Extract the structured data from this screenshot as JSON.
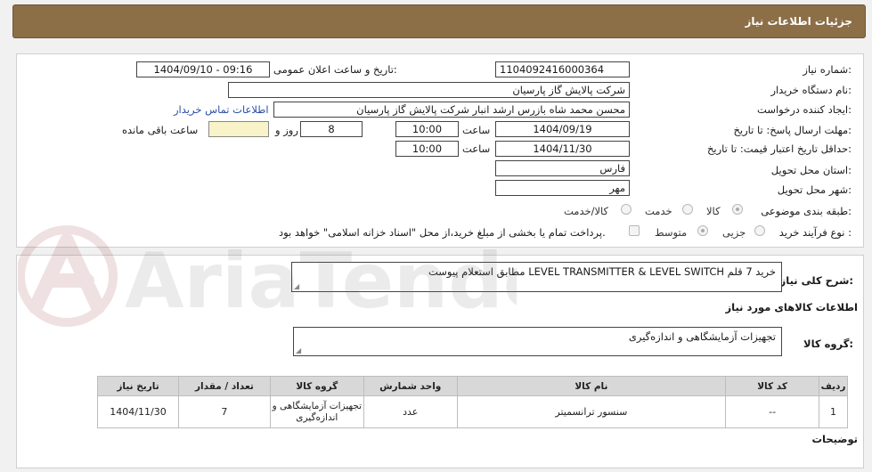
{
  "header": {
    "title": "جزئیات اطلاعات نیاز"
  },
  "fields": {
    "need_number_label": "شماره نیاز:",
    "need_number": "1104092416000364",
    "announce_label": "تاریخ و ساعت اعلان عمومی:",
    "announce_value": "1404/09/10 - 09:16",
    "buyer_org_label": "نام دستگاه خریدار:",
    "buyer_org": "شرکت پالایش گاز پارسیان",
    "requester_label": "ایجاد کننده درخواست:",
    "requester": "محسن محمد شاه بازرس ارشد انبار شرکت پالایش گاز پارسیان",
    "contact_link": "اطلاعات تماس خریدار",
    "deadline_label": "مهلت ارسال پاسخ: تا تاریخ:",
    "deadline_date": "1404/09/19",
    "time_label": "ساعت",
    "deadline_time": "10:00",
    "days_value": "8",
    "days_label": "روز و",
    "remaining_label": "ساعت باقی مانده",
    "remaining_value": "",
    "validity_label": "حداقل تاریخ اعتبار قیمت: تا تاریخ:",
    "validity_date": "1404/11/30",
    "validity_time_label": "ساعت",
    "validity_time": "10:00",
    "province_label": "استان محل تحویل:",
    "province": "فارس",
    "city_label": "شهر محل تحویل:",
    "city": "مهر",
    "category_label": "طبقه بندی موضوعی:",
    "category_options": [
      "کالا",
      "خدمت",
      "کالا/خدمت"
    ],
    "process_label": "نوع فرآیند خرید :",
    "process_options": [
      "جزیی",
      "متوسط"
    ],
    "payment_note": "پرداخت تمام یا بخشی از مبلغ خرید،از محل \"اسناد خزانه اسلامی\" خواهد بود."
  },
  "description": {
    "label": "شرح کلی نیاز:",
    "text": "خرید 7 قلم LEVEL TRANSMITTER & LEVEL SWITCH مطابق استعلام پیوست"
  },
  "goods": {
    "section_title": "اطلاعات کالاهای مورد نیاز",
    "group_label": "گروه کالا:",
    "group_value": "تجهیزات آزمایشگاهی و اندازه‌گیری",
    "columns": [
      "ردیف",
      "کد کالا",
      "نام کالا",
      "واحد شمارش",
      "گروه کالا",
      "تعداد / مقدار",
      "تاریخ نیاز"
    ],
    "rows": [
      [
        "1",
        "--",
        "سنسور ترانسمیتر",
        "عدد",
        "تجهیزات آزمایشگاهی و اندازه‌گیری",
        "7",
        "1404/11/30"
      ]
    ]
  },
  "notes": {
    "label": "توضیحات"
  },
  "watermark": {
    "text": "AriaTender.neT"
  },
  "colors": {
    "header_bg": "#8c6f47",
    "link": "#2b4ea8",
    "remaining_box": "#f8f3c8"
  }
}
